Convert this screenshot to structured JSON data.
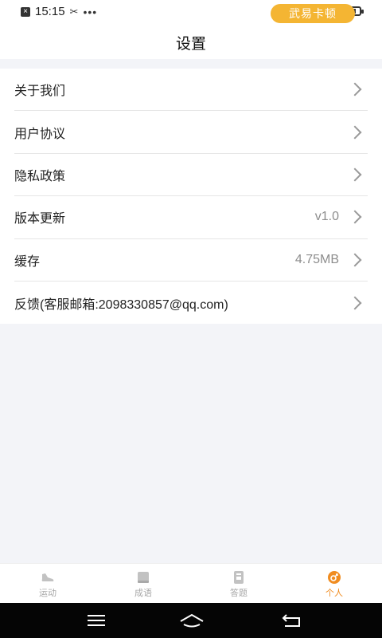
{
  "status_bar": {
    "time": "15:15",
    "dots": "•••"
  },
  "mode_pill": {
    "label": "武易卡顿"
  },
  "header": {
    "title": "设置"
  },
  "settings": [
    {
      "label": "关于我们",
      "value": ""
    },
    {
      "label": "用户协议",
      "value": ""
    },
    {
      "label": "隐私政策",
      "value": ""
    },
    {
      "label": "版本更新",
      "value": "v1.0"
    },
    {
      "label": "缓存",
      "value": "4.75MB"
    },
    {
      "label": "反馈(客服邮箱:2098330857@qq.com)",
      "value": ""
    }
  ],
  "tabs": [
    {
      "label": "运动",
      "icon": "sneaker-icon",
      "active": false
    },
    {
      "label": "成语",
      "icon": "book-icon",
      "active": false
    },
    {
      "label": "答题",
      "icon": "quiz-icon",
      "active": false
    },
    {
      "label": "个人",
      "icon": "profile-icon",
      "active": true
    }
  ],
  "colors": {
    "accent": "#f08c20",
    "pill": "#f4b533",
    "background": "#f3f4f8"
  }
}
